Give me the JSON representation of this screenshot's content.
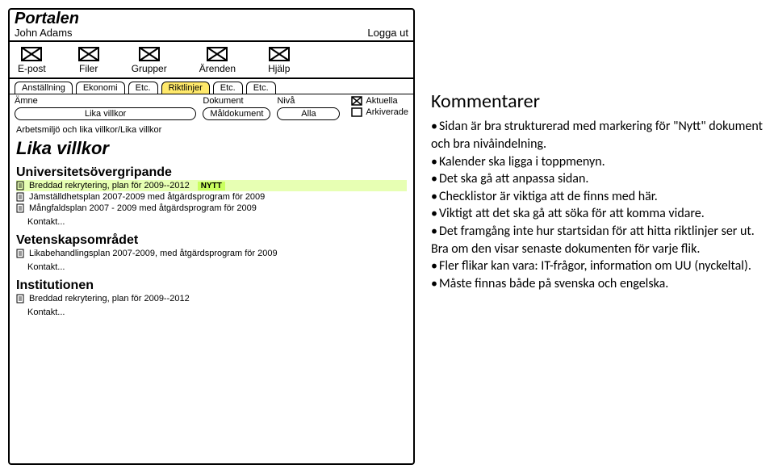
{
  "portal": {
    "title": "Portalen",
    "user": "John Adams",
    "logout": "Logga ut"
  },
  "mainTabs": [
    "E-post",
    "Filer",
    "Grupper",
    "Ärenden",
    "Hjälp"
  ],
  "subTabs": [
    "Anställning",
    "Ekonomi",
    "Etc.",
    "Riktlinjer",
    "Etc.",
    "Etc."
  ],
  "subTabActive": 3,
  "filters": {
    "amne": {
      "label": "Ämne",
      "value": "Lika villkor"
    },
    "dokument": {
      "label": "Dokument",
      "value": "Måldokument"
    },
    "niva": {
      "label": "Nivå",
      "value": "Alla"
    },
    "aktuella": "Aktuella",
    "arkiverade": "Arkiverade"
  },
  "breadcrumb": "Arbetsmiljö och lika villkor/Lika villkor",
  "pageTitle": "Lika villkor",
  "sections": [
    {
      "title": "Universitetsövergripande",
      "items": [
        {
          "text": "Breddad rekrytering, plan för 2009--2012",
          "nytt": true
        },
        {
          "text": "Jämställdhetsplan 2007-2009 med åtgärdsprogram för 2009",
          "nytt": false
        },
        {
          "text": "Mångfaldsplan 2007 - 2009 med åtgärdsprogram för 2009",
          "nytt": false
        }
      ],
      "kontakt": "Kontakt..."
    },
    {
      "title": "Vetenskapsområdet",
      "items": [
        {
          "text": "Likabehandlingsplan 2007-2009, med åtgärdsprogram för 2009",
          "nytt": false
        }
      ],
      "kontakt": "Kontakt..."
    },
    {
      "title": "Institutionen",
      "items": [
        {
          "text": "Breddad rekrytering, plan för 2009--2012",
          "nytt": false
        }
      ],
      "kontakt": "Kontakt..."
    }
  ],
  "nyttLabel": "NYTT",
  "comments": {
    "heading": "Kommentarer",
    "bullets": [
      "Sidan är bra strukturerad med markering för \"Nytt\" dokument och bra nivåindelning.",
      "Kalender ska ligga i toppmenyn.",
      "Det ska gå att anpassa sidan.",
      "Checklistor är viktiga att de finns med här.",
      "Viktigt att det ska gå att söka för att komma vidare.",
      "Det framgång inte hur startsidan för att hitta riktlinjer ser ut. Bra om den visar senaste dokumenten för varje flik.",
      "Fler flikar kan vara: IT-frågor, information om UU (nyckeltal).",
      "Måste finnas både på svenska och engelska."
    ]
  }
}
